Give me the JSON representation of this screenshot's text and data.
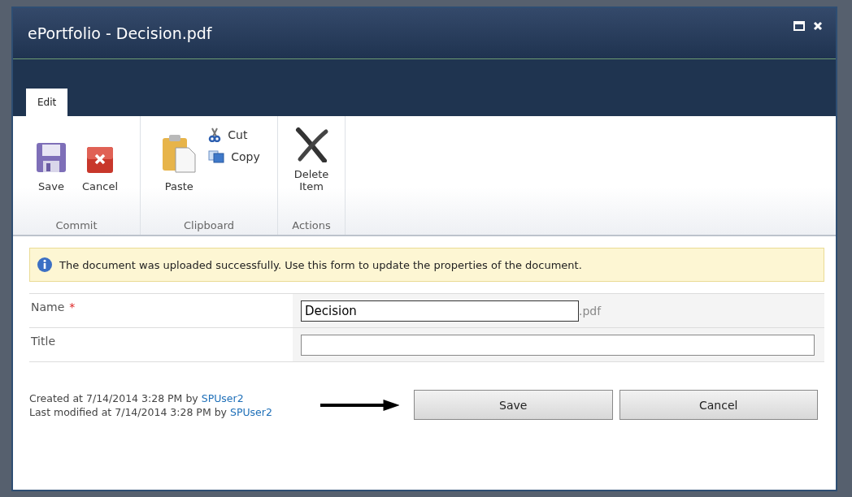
{
  "window": {
    "title": "ePortfolio - Decision.pdf"
  },
  "tabs": [
    {
      "label": "Edit",
      "selected": true
    }
  ],
  "ribbon": {
    "groups": [
      {
        "label": "Commit",
        "items": [
          {
            "label": "Save"
          },
          {
            "label": "Cancel"
          }
        ]
      },
      {
        "label": "Clipboard",
        "items": [
          {
            "label": "Paste"
          },
          {
            "label": "Cut"
          },
          {
            "label": "Copy"
          }
        ]
      },
      {
        "label": "Actions",
        "items": [
          {
            "label": "Delete Item"
          }
        ]
      }
    ]
  },
  "message": "The document was uploaded successfully. Use this form to update the properties of the document.",
  "fields": [
    {
      "label": "Name",
      "required_mark": "*",
      "value": "Decision",
      "suffix": ".pdf"
    },
    {
      "label": "Title"
    }
  ],
  "footer": {
    "created": {
      "text": "Created at 7/14/2014 3:28 PM by",
      "user": "SPUser2"
    },
    "modified": {
      "text": "Last modified at 7/14/2014 3:28 PM by",
      "user": "SPUser2"
    }
  },
  "buttons": [
    "Save",
    "Cancel"
  ]
}
